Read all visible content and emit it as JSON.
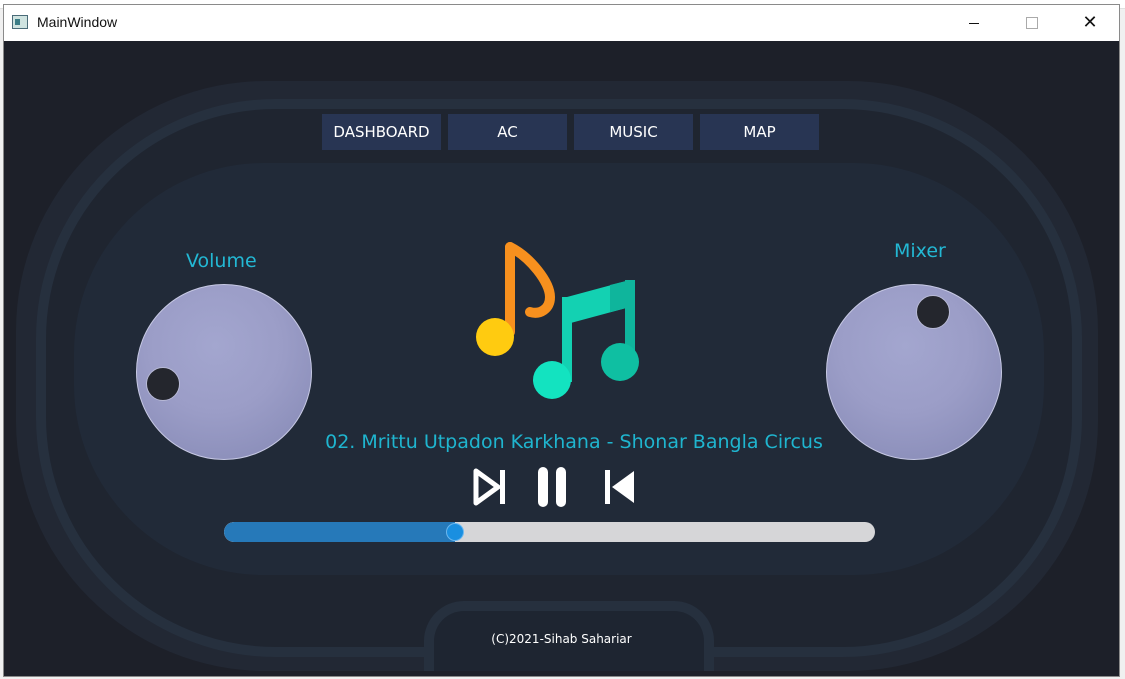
{
  "window": {
    "title": "MainWindow",
    "minimize_glyph": "",
    "maximize_glyph": "",
    "close_glyph": "✕"
  },
  "nav": {
    "dashboard": "DASHBOARD",
    "ac": "AC",
    "music": "MUSIC",
    "map": "MAP"
  },
  "volume": {
    "label": "Volume"
  },
  "mixer": {
    "label": "Mixer"
  },
  "player": {
    "track_title": "02. Mrittu Utpadon Karkhana - Shonar Bangla Circus",
    "progress": 0.355
  },
  "icons": {
    "music": "music-notes-icon",
    "next": "skip-forward-icon",
    "pause": "pause-icon",
    "previous": "skip-back-icon"
  },
  "colors": {
    "accent": "#23b8d4",
    "nav_bg": "#283553",
    "progress_fill": "#2679b9",
    "knob": "#9b9dc7",
    "background": "#1d2029"
  },
  "footer": {
    "copyright": "(C)2021-Sihab Sahariar"
  }
}
